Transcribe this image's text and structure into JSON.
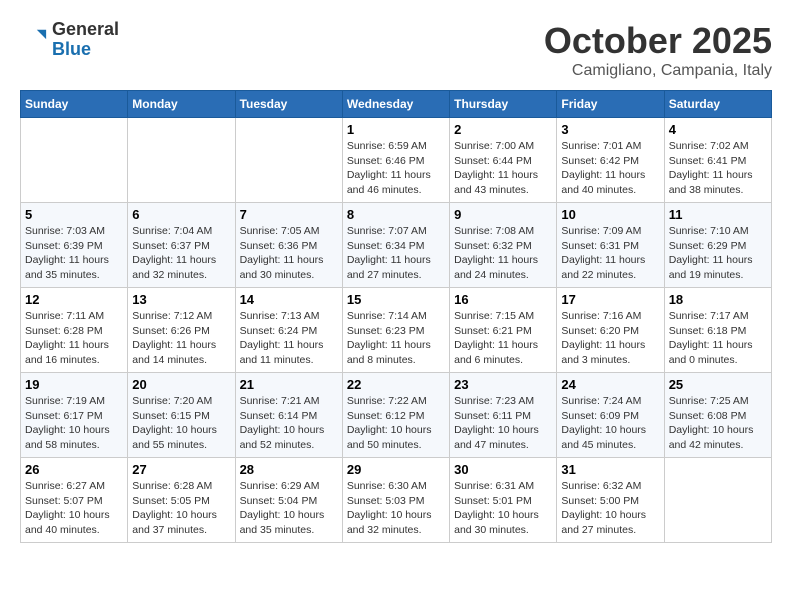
{
  "header": {
    "logo": {
      "general": "General",
      "blue": "Blue"
    },
    "title": "October 2025",
    "location": "Camigliano, Campania, Italy"
  },
  "calendar": {
    "weekdays": [
      "Sunday",
      "Monday",
      "Tuesday",
      "Wednesday",
      "Thursday",
      "Friday",
      "Saturday"
    ],
    "weeks": [
      [
        {
          "day": "",
          "info": ""
        },
        {
          "day": "",
          "info": ""
        },
        {
          "day": "",
          "info": ""
        },
        {
          "day": "1",
          "info": "Sunrise: 6:59 AM\nSunset: 6:46 PM\nDaylight: 11 hours\nand 46 minutes."
        },
        {
          "day": "2",
          "info": "Sunrise: 7:00 AM\nSunset: 6:44 PM\nDaylight: 11 hours\nand 43 minutes."
        },
        {
          "day": "3",
          "info": "Sunrise: 7:01 AM\nSunset: 6:42 PM\nDaylight: 11 hours\nand 40 minutes."
        },
        {
          "day": "4",
          "info": "Sunrise: 7:02 AM\nSunset: 6:41 PM\nDaylight: 11 hours\nand 38 minutes."
        }
      ],
      [
        {
          "day": "5",
          "info": "Sunrise: 7:03 AM\nSunset: 6:39 PM\nDaylight: 11 hours\nand 35 minutes."
        },
        {
          "day": "6",
          "info": "Sunrise: 7:04 AM\nSunset: 6:37 PM\nDaylight: 11 hours\nand 32 minutes."
        },
        {
          "day": "7",
          "info": "Sunrise: 7:05 AM\nSunset: 6:36 PM\nDaylight: 11 hours\nand 30 minutes."
        },
        {
          "day": "8",
          "info": "Sunrise: 7:07 AM\nSunset: 6:34 PM\nDaylight: 11 hours\nand 27 minutes."
        },
        {
          "day": "9",
          "info": "Sunrise: 7:08 AM\nSunset: 6:32 PM\nDaylight: 11 hours\nand 24 minutes."
        },
        {
          "day": "10",
          "info": "Sunrise: 7:09 AM\nSunset: 6:31 PM\nDaylight: 11 hours\nand 22 minutes."
        },
        {
          "day": "11",
          "info": "Sunrise: 7:10 AM\nSunset: 6:29 PM\nDaylight: 11 hours\nand 19 minutes."
        }
      ],
      [
        {
          "day": "12",
          "info": "Sunrise: 7:11 AM\nSunset: 6:28 PM\nDaylight: 11 hours\nand 16 minutes."
        },
        {
          "day": "13",
          "info": "Sunrise: 7:12 AM\nSunset: 6:26 PM\nDaylight: 11 hours\nand 14 minutes."
        },
        {
          "day": "14",
          "info": "Sunrise: 7:13 AM\nSunset: 6:24 PM\nDaylight: 11 hours\nand 11 minutes."
        },
        {
          "day": "15",
          "info": "Sunrise: 7:14 AM\nSunset: 6:23 PM\nDaylight: 11 hours\nand 8 minutes."
        },
        {
          "day": "16",
          "info": "Sunrise: 7:15 AM\nSunset: 6:21 PM\nDaylight: 11 hours\nand 6 minutes."
        },
        {
          "day": "17",
          "info": "Sunrise: 7:16 AM\nSunset: 6:20 PM\nDaylight: 11 hours\nand 3 minutes."
        },
        {
          "day": "18",
          "info": "Sunrise: 7:17 AM\nSunset: 6:18 PM\nDaylight: 11 hours\nand 0 minutes."
        }
      ],
      [
        {
          "day": "19",
          "info": "Sunrise: 7:19 AM\nSunset: 6:17 PM\nDaylight: 10 hours\nand 58 minutes."
        },
        {
          "day": "20",
          "info": "Sunrise: 7:20 AM\nSunset: 6:15 PM\nDaylight: 10 hours\nand 55 minutes."
        },
        {
          "day": "21",
          "info": "Sunrise: 7:21 AM\nSunset: 6:14 PM\nDaylight: 10 hours\nand 52 minutes."
        },
        {
          "day": "22",
          "info": "Sunrise: 7:22 AM\nSunset: 6:12 PM\nDaylight: 10 hours\nand 50 minutes."
        },
        {
          "day": "23",
          "info": "Sunrise: 7:23 AM\nSunset: 6:11 PM\nDaylight: 10 hours\nand 47 minutes."
        },
        {
          "day": "24",
          "info": "Sunrise: 7:24 AM\nSunset: 6:09 PM\nDaylight: 10 hours\nand 45 minutes."
        },
        {
          "day": "25",
          "info": "Sunrise: 7:25 AM\nSunset: 6:08 PM\nDaylight: 10 hours\nand 42 minutes."
        }
      ],
      [
        {
          "day": "26",
          "info": "Sunrise: 6:27 AM\nSunset: 5:07 PM\nDaylight: 10 hours\nand 40 minutes."
        },
        {
          "day": "27",
          "info": "Sunrise: 6:28 AM\nSunset: 5:05 PM\nDaylight: 10 hours\nand 37 minutes."
        },
        {
          "day": "28",
          "info": "Sunrise: 6:29 AM\nSunset: 5:04 PM\nDaylight: 10 hours\nand 35 minutes."
        },
        {
          "day": "29",
          "info": "Sunrise: 6:30 AM\nSunset: 5:03 PM\nDaylight: 10 hours\nand 32 minutes."
        },
        {
          "day": "30",
          "info": "Sunrise: 6:31 AM\nSunset: 5:01 PM\nDaylight: 10 hours\nand 30 minutes."
        },
        {
          "day": "31",
          "info": "Sunrise: 6:32 AM\nSunset: 5:00 PM\nDaylight: 10 hours\nand 27 minutes."
        },
        {
          "day": "",
          "info": ""
        }
      ]
    ]
  }
}
